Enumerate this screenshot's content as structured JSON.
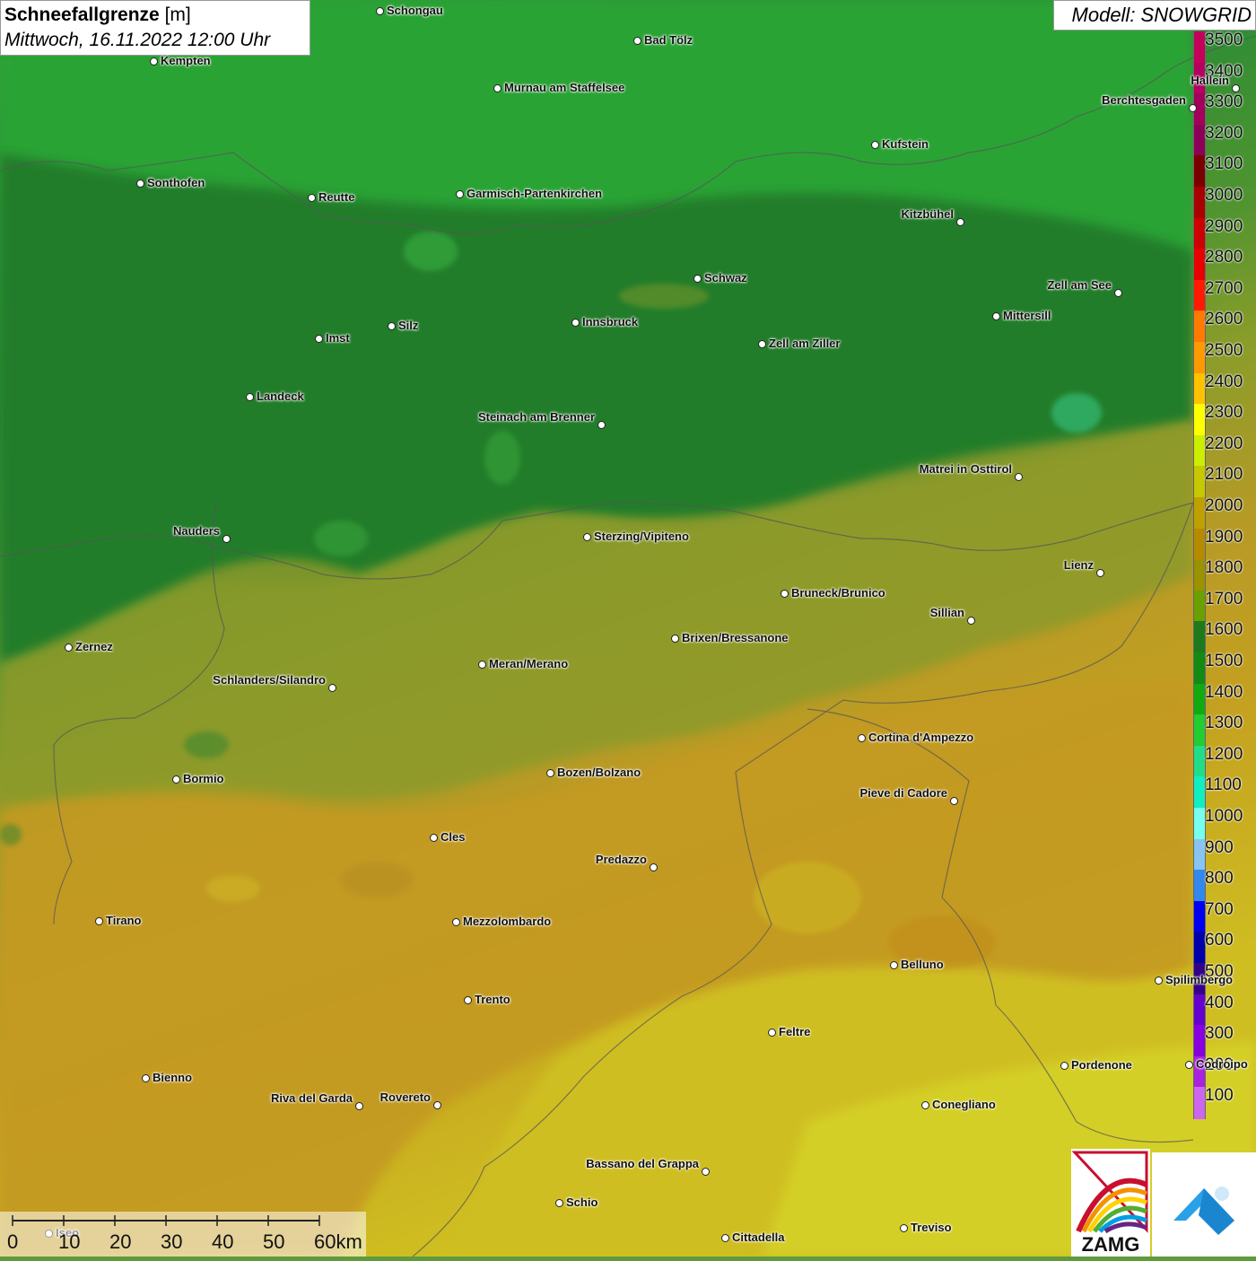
{
  "title": {
    "variable": "Schneefallgrenze",
    "unit": "[m]",
    "datetime": "Mittwoch, 16.11.2022 12:00 Uhr"
  },
  "model_label": "Modell: SNOWGRID",
  "legend": [
    {
      "value": "3500",
      "color": "#c3005a"
    },
    {
      "value": "3400",
      "color": "#b4005e"
    },
    {
      "value": "3300",
      "color": "#a2005c"
    },
    {
      "value": "3200",
      "color": "#8d0058"
    },
    {
      "value": "3100",
      "color": "#7a0000"
    },
    {
      "value": "3000",
      "color": "#a80000"
    },
    {
      "value": "2900",
      "color": "#cc0000"
    },
    {
      "value": "2800",
      "color": "#e60000"
    },
    {
      "value": "2700",
      "color": "#ff1a00"
    },
    {
      "value": "2600",
      "color": "#ff7a00"
    },
    {
      "value": "2500",
      "color": "#ff9900"
    },
    {
      "value": "2400",
      "color": "#ffc200"
    },
    {
      "value": "2300",
      "color": "#ffff00"
    },
    {
      "value": "2200",
      "color": "#ccee00"
    },
    {
      "value": "2100",
      "color": "#c6c800"
    },
    {
      "value": "2000",
      "color": "#bfa000"
    },
    {
      "value": "1900",
      "color": "#b68a00"
    },
    {
      "value": "1800",
      "color": "#9a9200"
    },
    {
      "value": "1700",
      "color": "#6aa000"
    },
    {
      "value": "1600",
      "color": "#1c7a1c"
    },
    {
      "value": "1500",
      "color": "#138a13"
    },
    {
      "value": "1400",
      "color": "#11aa11"
    },
    {
      "value": "1300",
      "color": "#22cc33"
    },
    {
      "value": "1200",
      "color": "#22dd88"
    },
    {
      "value": "1100",
      "color": "#11eec0"
    },
    {
      "value": "1000",
      "color": "#77ffee"
    },
    {
      "value": "900",
      "color": "#88c4f0"
    },
    {
      "value": "800",
      "color": "#3388ee"
    },
    {
      "value": "700",
      "color": "#0000ee"
    },
    {
      "value": "600",
      "color": "#0000aa"
    },
    {
      "value": "500",
      "color": "#330088"
    },
    {
      "value": "400",
      "color": "#6600cc"
    },
    {
      "value": "300",
      "color": "#8800dd"
    },
    {
      "value": "200",
      "color": "#aa22dd"
    },
    {
      "value": "100",
      "color": "#cc66ee"
    }
  ],
  "cities": [
    {
      "name": "Schongau"
    },
    {
      "name": "Kempten"
    },
    {
      "name": "Bad Tölz"
    },
    {
      "name": "Murnau am Staffelsee"
    },
    {
      "name": "Berchtesgaden"
    },
    {
      "name": "Hallein"
    },
    {
      "name": "Kufstein"
    },
    {
      "name": "Sonthofen"
    },
    {
      "name": "Reutte"
    },
    {
      "name": "Garmisch-Partenkirchen"
    },
    {
      "name": "Kitzbühel"
    },
    {
      "name": "Schwaz"
    },
    {
      "name": "Zell am See"
    },
    {
      "name": "Mittersill"
    },
    {
      "name": "Innsbruck"
    },
    {
      "name": "Silz"
    },
    {
      "name": "Imst"
    },
    {
      "name": "Zell am Ziller"
    },
    {
      "name": "Landeck"
    },
    {
      "name": "Steinach am Brenner"
    },
    {
      "name": "Matrei in Osttirol"
    },
    {
      "name": "Nauders"
    },
    {
      "name": "Sterzing/Vipiteno"
    },
    {
      "name": "Lienz"
    },
    {
      "name": "Bruneck/Brunico"
    },
    {
      "name": "Sillian"
    },
    {
      "name": "Zernez"
    },
    {
      "name": "Brixen/Bressanone"
    },
    {
      "name": "Meran/Merano"
    },
    {
      "name": "Schlanders/Silandro"
    },
    {
      "name": "Cortina d'Ampezzo"
    },
    {
      "name": "Bormio"
    },
    {
      "name": "Bozen/Bolzano"
    },
    {
      "name": "Pieve di Cadore"
    },
    {
      "name": "Cles"
    },
    {
      "name": "Predazzo"
    },
    {
      "name": "Tirano"
    },
    {
      "name": "Mezzolombardo"
    },
    {
      "name": "Belluno"
    },
    {
      "name": "Spilimbergo"
    },
    {
      "name": "Trento"
    },
    {
      "name": "Feltre"
    },
    {
      "name": "Pordenone"
    },
    {
      "name": "Codroipo"
    },
    {
      "name": "Bienno"
    },
    {
      "name": "Riva del Garda"
    },
    {
      "name": "Rovereto"
    },
    {
      "name": "Conegliano"
    },
    {
      "name": "Bassano del Grappa"
    },
    {
      "name": "Schio"
    },
    {
      "name": "Treviso"
    },
    {
      "name": "Cittadella"
    },
    {
      "name": "Iseo"
    }
  ],
  "scale": {
    "ticks": [
      "0",
      "10",
      "20",
      "30",
      "40",
      "50",
      "60km"
    ]
  },
  "logos": {
    "zamg": "ZAMG"
  }
}
